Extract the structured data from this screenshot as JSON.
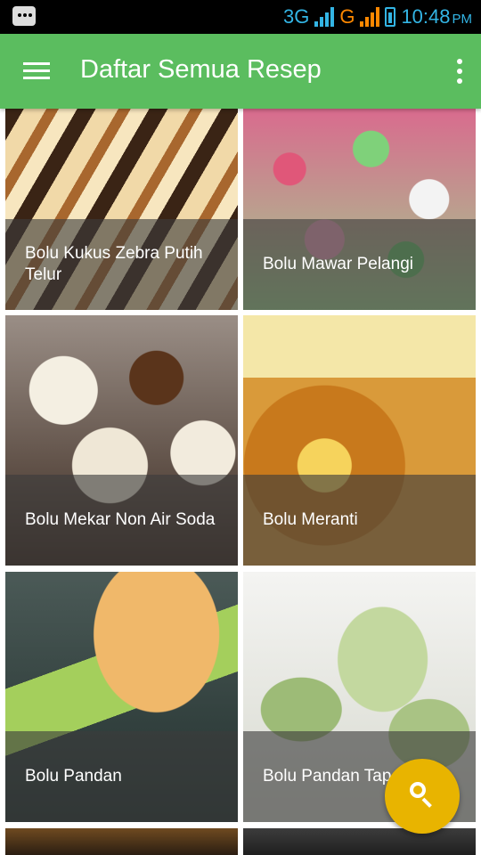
{
  "status_bar": {
    "net_1": "3G",
    "net_2": "G",
    "time": "10:48",
    "ampm": "PM",
    "colors": {
      "icons": "#33b5e5",
      "signal_2": "#ff8800"
    }
  },
  "app_bar": {
    "title": "Daftar Semua Resep",
    "menu_icon": "hamburger-menu-icon",
    "overflow_icon": "more-vert-icon",
    "color": "#5bbd5f"
  },
  "recipes": [
    {
      "label": "Bolu Kukus Zebra Putih Telur"
    },
    {
      "label": "Bolu Mawar Pelangi"
    },
    {
      "label": "Bolu Mekar Non Air Soda"
    },
    {
      "label": "Bolu Meranti"
    },
    {
      "label": "Bolu Pandan"
    },
    {
      "label": "Bolu Pandan Tape Ketan"
    }
  ],
  "fab": {
    "icon": "search-icon",
    "color": "#e8b400"
  }
}
